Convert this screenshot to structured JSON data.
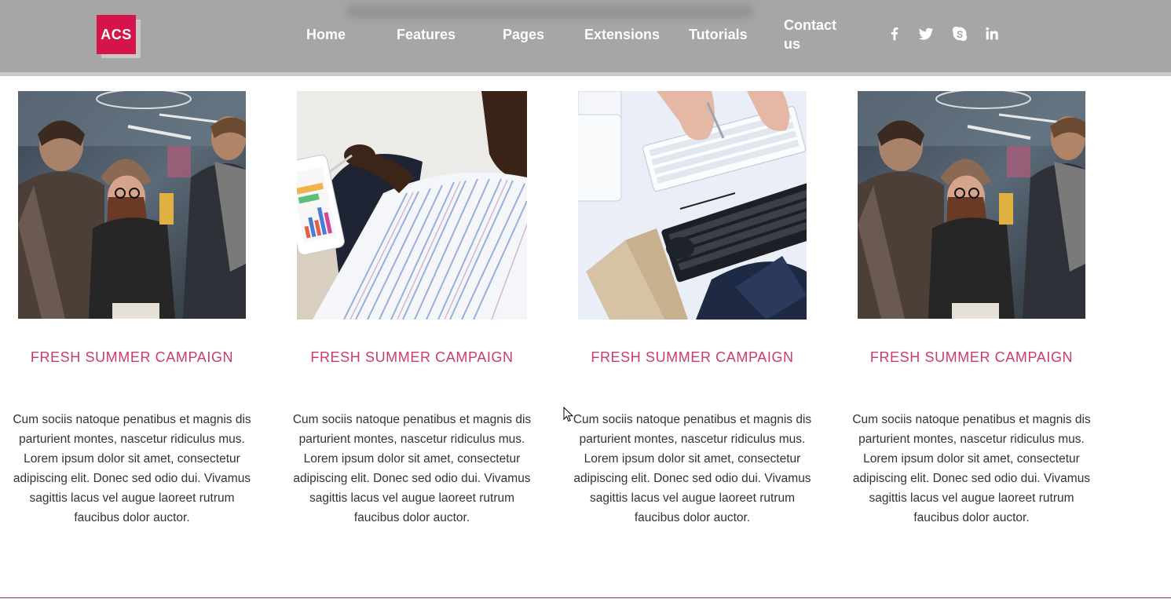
{
  "logo": {
    "text": "ACS",
    "color": "#d4144a"
  },
  "nav": {
    "home": "Home",
    "features": "Features",
    "pages": "Pages",
    "extensions": "Extensions",
    "tutorials": "Tutorials",
    "contact": "Contact us"
  },
  "social": [
    "facebook-icon",
    "twitter-icon",
    "skype-icon",
    "linkedin-icon"
  ],
  "colors": {
    "header": "#a6a6a6",
    "accent_title": "#cd3b6c",
    "body_text": "#333333"
  },
  "cards": [
    {
      "image": "team-meeting-photo",
      "title": "FRESH SUMMER CAMPAIGN",
      "text": "Cum sociis natoque penatibus et magnis dis parturient montes, nascetur ridiculus mus. Lorem ipsum dolor sit amet, consectetur adipiscing elit. Donec sed odio dui. Vivamus sagittis lacus vel augue laoreet rutrum faucibus dolor auctor."
    },
    {
      "image": "tablet-charts-photo",
      "title": "FRESH SUMMER CAMPAIGN",
      "text": "Cum sociis natoque penatibus et magnis dis parturient montes, nascetur ridiculus mus. Lorem ipsum dolor sit amet, consectetur adipiscing elit. Donec sed odio dui. Vivamus sagittis lacus vel augue laoreet rutrum faucibus dolor auctor."
    },
    {
      "image": "keyboards-desk-photo",
      "title": "FRESH SUMMER CAMPAIGN",
      "text": "Cum sociis natoque penatibus et magnis dis parturient montes, nascetur ridiculus mus. Lorem ipsum dolor sit amet, consectetur adipiscing elit. Donec sed odio dui. Vivamus sagittis lacus vel augue laoreet rutrum faucibus dolor auctor."
    },
    {
      "image": "team-meeting-photo",
      "title": "FRESH SUMMER CAMPAIGN",
      "text": "Cum sociis natoque penatibus et magnis dis parturient montes, nascetur ridiculus mus. Lorem ipsum dolor sit amet, consectetur adipiscing elit. Donec sed odio dui. Vivamus sagittis lacus vel augue laoreet rutrum faucibus dolor auctor."
    }
  ]
}
